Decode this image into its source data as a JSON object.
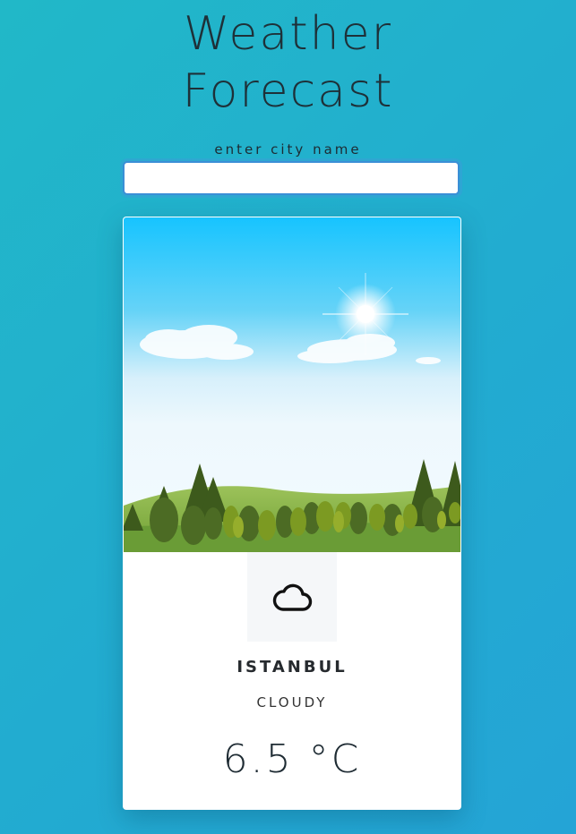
{
  "header": {
    "title_line1": "Weather",
    "title_line2": "Forecast"
  },
  "search": {
    "label": "enter city name",
    "value": "",
    "placeholder": ""
  },
  "weather_card": {
    "scene_image": "sky-forest-illustration",
    "condition_icon": "cloud-icon",
    "city": "ISTANBUL",
    "condition": "CLOUDY",
    "temperature": "6.5 °C"
  },
  "colors": {
    "background_start": "#21b8c8",
    "background_end": "#24a4d6",
    "card": "#ffffff",
    "input_border": "#3b8fd6"
  }
}
